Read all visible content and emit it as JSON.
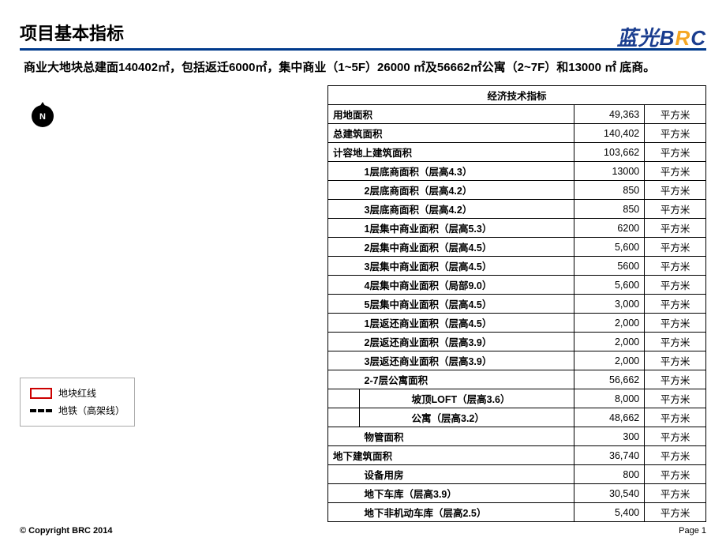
{
  "header": {
    "title": "项目基本指标",
    "logo_cn": "蓝光",
    "logo_b": "B",
    "logo_r": "R",
    "logo_c": "C"
  },
  "subtitle": "商业大地块总建面140402㎡，包括返迁6000㎡，集中商业（1~5F）26000 ㎡及56662㎡公寓（2~7F）和13000 ㎡ 底商。",
  "compass": "N",
  "legend": {
    "redline": "地块红线",
    "metro": "地铁（高架线）"
  },
  "table": {
    "caption": "经济技术指标",
    "unit": "平方米",
    "rows": [
      {
        "label": "用地面积",
        "value": "49,363",
        "level": 0
      },
      {
        "label": "总建筑面积",
        "value": "140,402",
        "level": 0
      },
      {
        "label": "计容地上建筑面积",
        "value": "103,662",
        "level": 0
      },
      {
        "label": "1层底商面积（层高4.3）",
        "value": "13000",
        "level": 1
      },
      {
        "label": "2层底商面积（层高4.2）",
        "value": "850",
        "level": 1
      },
      {
        "label": "3层底商面积（层高4.2）",
        "value": "850",
        "level": 1
      },
      {
        "label": "1层集中商业面积（层高5.3）",
        "value": "6200",
        "level": 1
      },
      {
        "label": "2层集中商业面积（层高4.5）",
        "value": "5,600",
        "level": 1
      },
      {
        "label": "3层集中商业面积（层高4.5）",
        "value": "5600",
        "level": 1
      },
      {
        "label": "4层集中商业面积（局部9.0）",
        "value": "5,600",
        "level": 1
      },
      {
        "label": "5层集中商业面积（层高4.5）",
        "value": "3,000",
        "level": 1
      },
      {
        "label": "1层返还商业面积（层高4.5）",
        "value": "2,000",
        "level": 1
      },
      {
        "label": "2层返还商业面积（层高3.9）",
        "value": "2,000",
        "level": 1
      },
      {
        "label": "3层返还商业面积（层高3.9）",
        "value": "2,000",
        "level": 1
      },
      {
        "label": "2-7层公寓面积",
        "value": "56,662",
        "level": 1
      },
      {
        "label": "坡顶LOFT（层高3.6）",
        "value": "8,000",
        "level": 2
      },
      {
        "label": "公寓（层高3.2）",
        "value": "48,662",
        "level": 2
      },
      {
        "label": "物管面积",
        "value": "300",
        "level": 1
      },
      {
        "label": "地下建筑面积",
        "value": "36,740",
        "level": 0
      },
      {
        "label": "设备用房",
        "value": "800",
        "level": 1
      },
      {
        "label": "地下车库（层高3.9）",
        "value": "30,540",
        "level": 1
      },
      {
        "label": "地下非机动车库（层高2.5）",
        "value": "5,400",
        "level": 1
      }
    ]
  },
  "footer": {
    "copyright": "© Copyright BRC 2014",
    "page": "Page 1"
  }
}
